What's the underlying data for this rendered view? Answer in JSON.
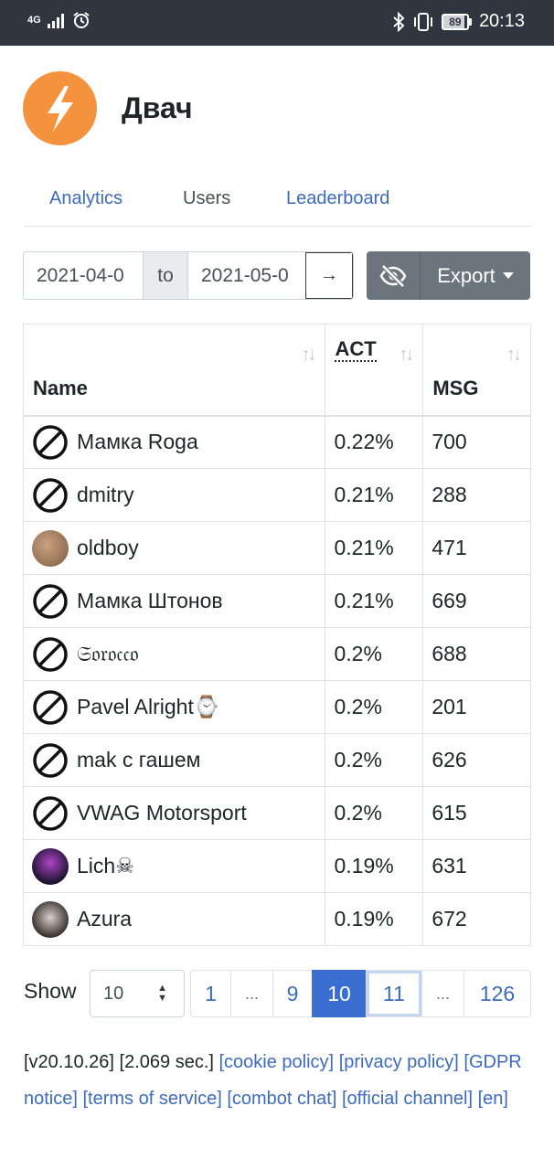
{
  "status_bar": {
    "network": "4G",
    "battery": "89",
    "battery_level": 0.89,
    "time": "20:13",
    "icons": [
      "signal-icon",
      "alarm-icon",
      "bluetooth-icon",
      "vibrate-icon",
      "battery-icon"
    ]
  },
  "header": {
    "title": "Двач",
    "logo_icon": "lightning-icon",
    "logo_color": "#f5923e"
  },
  "tabs": [
    {
      "label": "Analytics",
      "active": false
    },
    {
      "label": "Users",
      "active": true
    },
    {
      "label": "Leaderboard",
      "active": false
    }
  ],
  "date_range": {
    "from": "2021-04-0",
    "to_label": "to",
    "to": "2021-05-0",
    "go_label": "→"
  },
  "toolbar": {
    "hide_icon": "eye-slash-icon",
    "export_label": "Export"
  },
  "table": {
    "headers": {
      "name": "Name",
      "act": "ACT",
      "msg": "MSG"
    },
    "rows": [
      {
        "name": "Мамка Roga",
        "act": "0.22%",
        "msg": "700",
        "avatar": "ban-icon"
      },
      {
        "name": "dmitry",
        "act": "0.21%",
        "msg": "288",
        "avatar": "ban-icon"
      },
      {
        "name": "oldboy",
        "act": "0.21%",
        "msg": "471",
        "avatar": "photo"
      },
      {
        "name": "Мамка Штонов",
        "act": "0.21%",
        "msg": "669",
        "avatar": "ban-icon"
      },
      {
        "name": "𝔖𝔬𝔯𝔬𝔠𝔠𝔬",
        "act": "0.2%",
        "msg": "688",
        "avatar": "ban-icon"
      },
      {
        "name": "Pavel Alright⌚",
        "act": "0.2%",
        "msg": "201",
        "avatar": "ban-icon"
      },
      {
        "name": "mak с гашем",
        "act": "0.2%",
        "msg": "626",
        "avatar": "ban-icon"
      },
      {
        "name": "VWAG Motorsport",
        "act": "0.2%",
        "msg": "615",
        "avatar": "ban-icon"
      },
      {
        "name": "Lich☠",
        "act": "0.19%",
        "msg": "631",
        "avatar": "photo"
      },
      {
        "name": "Azura",
        "act": "0.19%",
        "msg": "672",
        "avatar": "photo"
      }
    ]
  },
  "pagination": {
    "show_label": "Show",
    "page_size": "10",
    "pages": [
      {
        "label": "1",
        "state": "normal"
      },
      {
        "label": "...",
        "state": "ellipsis"
      },
      {
        "label": "9",
        "state": "normal"
      },
      {
        "label": "10",
        "state": "active"
      },
      {
        "label": "11",
        "state": "focus"
      },
      {
        "label": "...",
        "state": "ellipsis"
      },
      {
        "label": "126",
        "state": "normal"
      }
    ]
  },
  "footer": {
    "version": "[v20.10.26]",
    "timing": "[2.069 sec.]",
    "links": [
      "[cookie policy]",
      "[privacy policy]",
      "[GDPR notice]",
      "[terms of service]",
      "[combot chat]",
      "[official channel]",
      "[en]"
    ]
  }
}
